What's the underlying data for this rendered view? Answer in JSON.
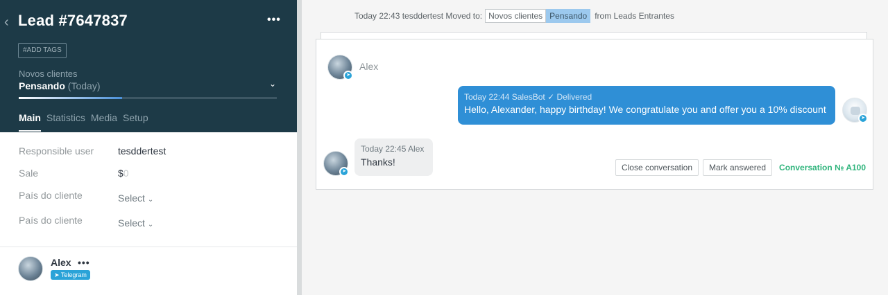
{
  "lead": {
    "title": "Lead #7647837",
    "more_label": "•••",
    "add_tags_label": "#ADD TAGS",
    "pipeline": "Novos clientes",
    "stage": "Pensando",
    "stage_time": "(Today)",
    "stage_progress_percent": 40
  },
  "tabs": [
    {
      "label": "Main",
      "active": true
    },
    {
      "label": "Statistics",
      "active": false
    },
    {
      "label": "Media",
      "active": false
    },
    {
      "label": "Setup",
      "active": false
    }
  ],
  "fields": {
    "responsible_label": "Responsible user",
    "responsible_value": "tesddertest",
    "sale_label": "Sale",
    "sale_currency": "$",
    "sale_placeholder": "0",
    "country1_label": "País do cliente",
    "country1_value": "Select",
    "country2_label": "País do cliente",
    "country2_value": "Select"
  },
  "contact": {
    "name": "Alex",
    "more_label": "•••",
    "channel": "Telegram"
  },
  "feed": {
    "moved_prefix": "Today 22:43 tesddertest Moved to:",
    "from_stage": "Novos clientes",
    "to_stage": "Pensando",
    "moved_suffix": "from Leads Entrantes",
    "chat_header_name": "Alex",
    "bot_meta": "Today 22:44 SalesBot ✓ Delivered",
    "bot_text": "Hello, Alexander, happy birthday! We congratulate you and offer you a 10% discount",
    "user_meta": "Today 22:45 Alex",
    "user_text": "Thanks!",
    "close_conversation_label": "Close conversation",
    "mark_answered_label": "Mark answered",
    "conversation_id": "Conversation № A100"
  },
  "colors": {
    "header_bg": "#1d3a47",
    "bot_bubble": "#2f8fd6",
    "telegram": "#2aa3d8",
    "conversation_id": "#2fb47c"
  }
}
